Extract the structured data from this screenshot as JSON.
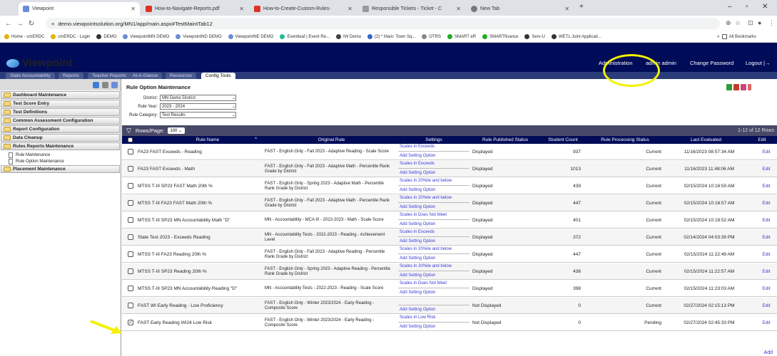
{
  "browser": {
    "tabs": [
      {
        "label": "Viewpoint",
        "active": true
      },
      {
        "label": "How-to-Navigate-Reports.pdf",
        "active": false
      },
      {
        "label": "How-to-Create-Custom-Rules-",
        "active": false
      },
      {
        "label": "Responsible Tickets - Ticket - C",
        "active": false
      },
      {
        "label": "New Tab",
        "active": false
      }
    ],
    "url": "demo.viewpointsolution.org/MN1/app/main.aspx#TestMaintTab12",
    "bookmarks": [
      "Home - cmERDC",
      "cmERDC - Login",
      "DEMO",
      "ViewpointMN DEMO",
      "ViewpointND DEMO",
      "ViewpointNE DEMO",
      "Eventleaf | Event Re...",
      "IW Demo",
      "(2) * Main: Town Sq...",
      "OTRS",
      "SMART eR",
      "SMARTfinance",
      "Serv-U",
      "WETL Joint Applicati..."
    ],
    "all_bookmarks": "All Bookmarks"
  },
  "app": {
    "logo": "Viewpoint",
    "header_links": [
      "Administration",
      "admin admin",
      "Change Password",
      "Logout"
    ],
    "tabs": [
      "State Accountability",
      "Reports",
      "Teacher Reports",
      "At-A-Glance",
      "Resources",
      "Config Tools"
    ],
    "active_tab": "Config Tools"
  },
  "sidebar": {
    "items": [
      "Dashboard Maintenance",
      "Test Score Entry",
      "Test Definitions",
      "Common Assessment Configuration",
      "Report Configuration",
      "Data Cleanup",
      "Rules Reports Maintenance"
    ],
    "subitems": [
      "Rule Maintenance",
      "Rule Option Maintenance"
    ],
    "last_item": "Placement Maintenance"
  },
  "main": {
    "title": "Rule Option Maintenance",
    "filters": [
      {
        "label": "District:",
        "value": "MN Demo District"
      },
      {
        "label": "Rule Year:",
        "value": "2023 - 2024"
      },
      {
        "label": "Rule Category:",
        "value": "Test Results"
      }
    ],
    "rows_per_page_label": "Rows/Page:",
    "rows_per_page": "100",
    "range": "1-12 of 12 Rows",
    "columns": [
      "Rule Name",
      "Original Rule",
      "Settings",
      "Rule Published Status",
      "Student Count",
      "Rule Processing Status",
      "Last Evaluated",
      "Edit"
    ],
    "add_label": "Add",
    "rows": [
      {
        "name": "FA23 FAST Exceeds - Reading",
        "original": "FAST - English Only - Fall 2023 - Adaptive Reading - Scale Score",
        "setting": "Scales in Exceeds",
        "add_setting": "Add Setting Option",
        "published": "Displayed",
        "count": "937",
        "processing": "Current",
        "evaluated": "11/16/2023 08:57:34 AM",
        "edit": "Edit",
        "checked": false
      },
      {
        "name": "FA23 FAST Exceeds - Math",
        "original": "FAST - English Only - Fall 2023 - Adaptive Math - Percentile Rank Grade by District",
        "setting": "Scales in Exceeds",
        "add_setting": "Add Setting Option",
        "published": "Displayed",
        "count": "1013",
        "processing": "Current",
        "evaluated": "11/16/2023 11:48:06 AM",
        "edit": "Edit",
        "checked": false
      },
      {
        "name": "MTSS T-III SP23 FAST Math 20th %",
        "original": "FAST - English Only - Spring 2023 - Adaptive Math - Percentile Rank Grade by District",
        "setting": "Scales in 20%ile and below",
        "add_setting": "Add Setting Option",
        "published": "Displayed",
        "count": "439",
        "processing": "Current",
        "evaluated": "02/15/2024 10:16:50 AM",
        "edit": "Edit",
        "checked": false
      },
      {
        "name": "MTSS T-III FA23 FAST Math 20th %",
        "original": "FAST - English Only - Fall 2023 - Adaptive Math - Percentile Rank Grade by District",
        "setting": "Scales in 20%ile and below",
        "add_setting": "Add Setting Option",
        "published": "Displayed",
        "count": "447",
        "processing": "Current",
        "evaluated": "02/15/2024 10:16:57 AM",
        "edit": "Edit",
        "checked": false
      },
      {
        "name": "MTSS T-III SP23 MN Accountability Math \"D\"",
        "original": "MN - Accountability - MCA III - 2022-2023 - Math - Scale Score",
        "setting": "Scales in Does Not Meet",
        "add_setting": "Add Setting Option",
        "published": "Displayed",
        "count": "401",
        "processing": "Current",
        "evaluated": "02/15/2024 10:18:52 AM",
        "edit": "Edit",
        "checked": false
      },
      {
        "name": "State Test 2023 - Exceeds Reading",
        "original": "MN - Accountability Tests - 2022-2023 - Reading - Achievement Level",
        "setting": "Scales in Exceeds",
        "add_setting": "Add Setting Option",
        "published": "Displayed",
        "count": "372",
        "processing": "Current",
        "evaluated": "02/14/2024 04:03:39 PM",
        "edit": "Edit",
        "checked": false
      },
      {
        "name": "MTSS T-III FA23 Reading 20th %",
        "original": "FAST - English Only - Fall 2023 - Adaptive Reading - Percentile Rank Grade by District",
        "setting": "Scales in 20%ile and below",
        "add_setting": "Add Setting Option",
        "published": "Displayed",
        "count": "447",
        "processing": "Current",
        "evaluated": "02/15/2024 11:22:49 AM",
        "edit": "Edit",
        "checked": false
      },
      {
        "name": "MTSS T-III SP23 Reading 20th %",
        "original": "FAST - English Only - Spring 2023 - Adaptive Reading - Percentile Rank Grade by District",
        "setting": "Scales in 20%ile and below",
        "add_setting": "Add Setting Option",
        "published": "Displayed",
        "count": "438",
        "processing": "Current",
        "evaluated": "02/15/2024 11:22:57 AM",
        "edit": "Edit",
        "checked": false
      },
      {
        "name": "MTSS T-III SP23 MN Accountability Reading \"D\"",
        "original": "MN - Accountability Tests - 2022-2023 - Reading - Scale Score",
        "setting": "Scales in Does Not Meet",
        "add_setting": "Add Setting Option",
        "published": "Displayed",
        "count": "398",
        "processing": "Current",
        "evaluated": "02/15/2024 11:23:03 AM",
        "edit": "Edit",
        "checked": false
      },
      {
        "name": "FAST WI Early Reading - Low Proficiency",
        "original": "FAST - English Only - Winter 2023/2024 - Early Reading - Composite Score",
        "setting": "",
        "add_setting": "Add Setting Option",
        "published": "Not Displayed",
        "count": "0",
        "processing": "Current",
        "evaluated": "02/27/2024 02:15:13 PM",
        "edit": "Edit",
        "checked": false
      },
      {
        "name": "FAST Early Reading WI24 Low Risk",
        "original": "FAST - English Only - Winter 2023/2024 - Early Reading - Composite Score",
        "setting": "Scales in Low Risk",
        "add_setting": "Add Setting Option",
        "published": "Not Displayed",
        "count": "0",
        "processing": "Pending",
        "evaluated": "02/27/2024 02:45:33 PM",
        "edit": "Edit",
        "checked": true
      }
    ]
  },
  "colors": {
    "header_bg": "#000c58",
    "grid_bar": "#484868",
    "link": "#3b3bd4",
    "highlight": "#f4f100"
  }
}
